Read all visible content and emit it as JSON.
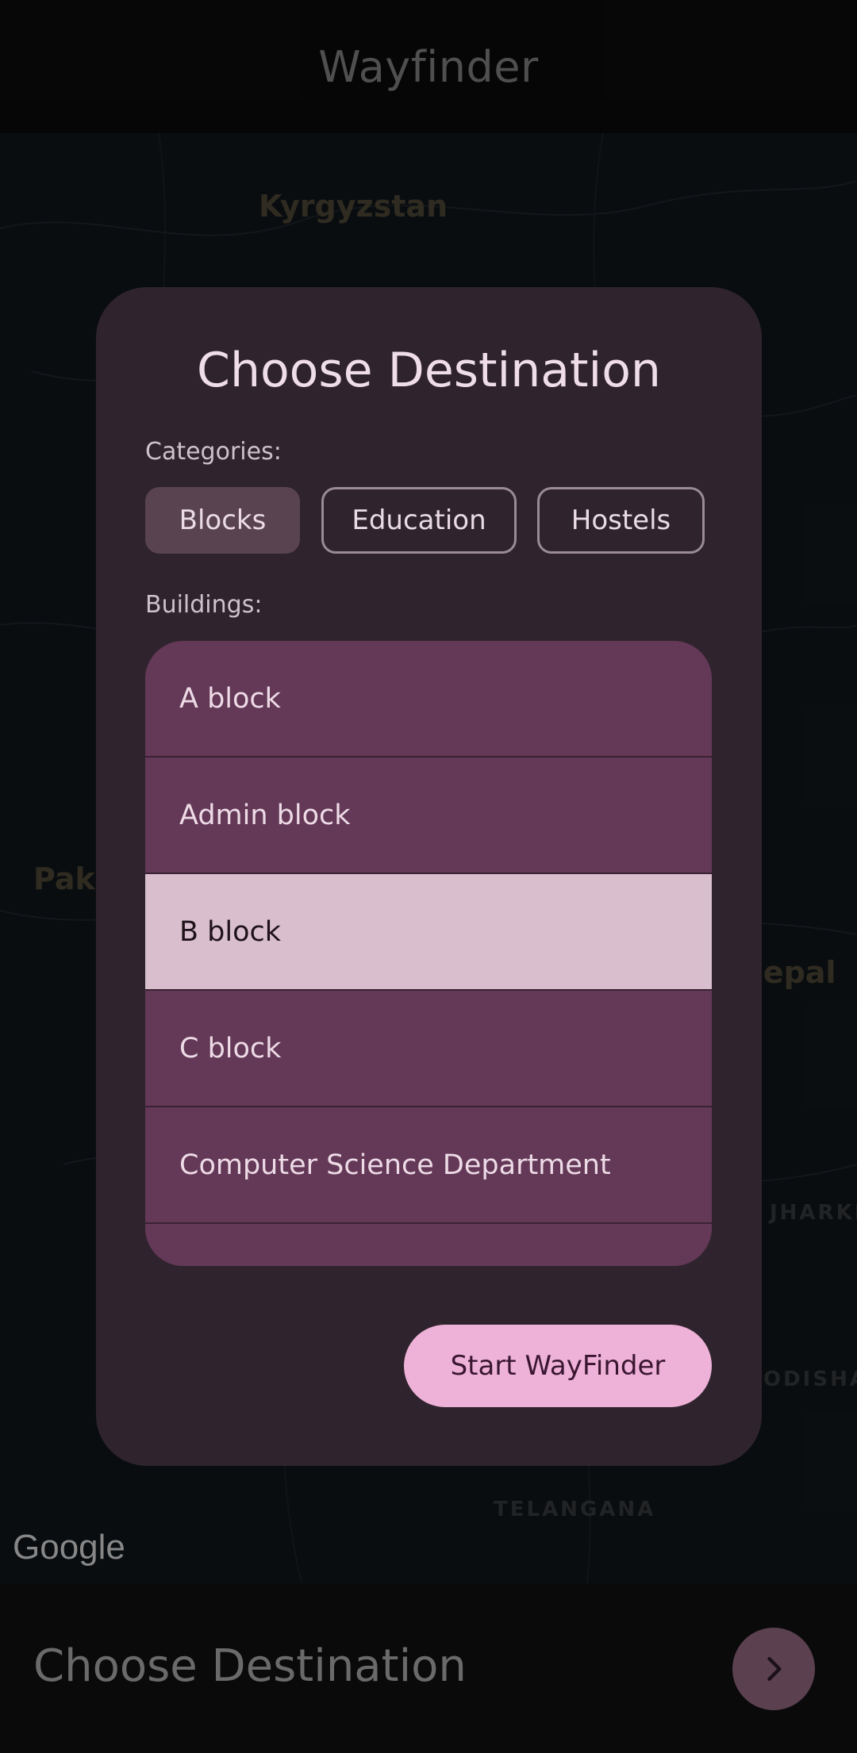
{
  "app": {
    "title": "Wayfinder"
  },
  "map": {
    "labels": [
      "Kyrgyzstan",
      "Paki",
      "Nepal",
      "JHARKH",
      "ODISHA",
      "TELANGANA"
    ],
    "google_logo": "Google"
  },
  "dialog": {
    "title": "Choose Destination",
    "categories_label": "Categories:",
    "categories": [
      {
        "label": "Blocks",
        "selected": true
      },
      {
        "label": "Education",
        "selected": false
      },
      {
        "label": "Hostels",
        "selected": false
      }
    ],
    "buildings_label": "Buildings:",
    "buildings": [
      {
        "label": "A block",
        "selected": false
      },
      {
        "label": "Admin block",
        "selected": false
      },
      {
        "label": "B block",
        "selected": true
      },
      {
        "label": "C block",
        "selected": false
      },
      {
        "label": "Computer Science Department",
        "selected": false
      }
    ],
    "start_button": "Start WayFinder"
  },
  "bottom_bar": {
    "title": "Choose Destination",
    "next_icon": "chevron-right-icon"
  },
  "colors": {
    "dialog_bg": "#2f242d",
    "list_item": "#643857",
    "list_item_selected": "#d9bfce",
    "primary_button": "#eeb2d8"
  }
}
